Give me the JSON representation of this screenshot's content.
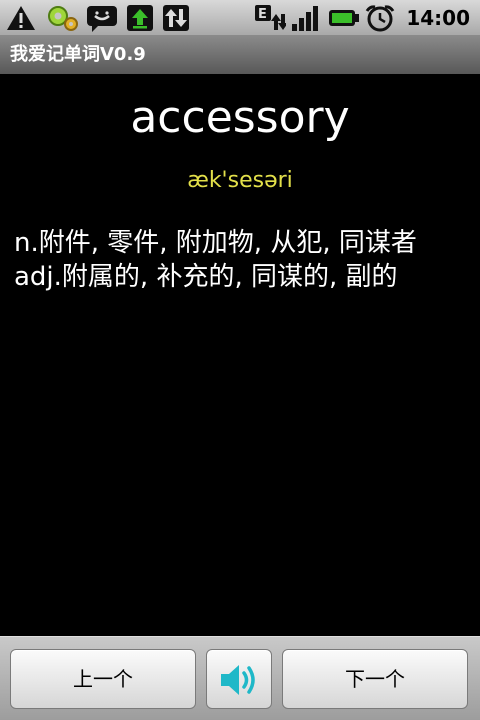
{
  "status_bar": {
    "icons": [
      "warning-icon",
      "settings-gear-icon",
      "chat-icon",
      "upload-icon",
      "data-transfer-icon",
      "edge-network-icon",
      "signal-icon",
      "battery-icon",
      "alarm-clock-icon"
    ],
    "time": "14:00",
    "colors": {
      "accent_green": "#3bbf2a",
      "background": "#bdbdbd"
    }
  },
  "app": {
    "title": "我爱记单词V0.9"
  },
  "word_card": {
    "word": "accessory",
    "phonetic": "æk'sesəri",
    "definition_lines": [
      "n.附件, 零件, 附加物, 从犯, 同谋者",
      "adj.附属的, 补充的, 同谋的, 副的"
    ],
    "colors": {
      "phonetic": "#e3e04a",
      "text": "#ffffff",
      "background": "#000000"
    }
  },
  "controls": {
    "prev_label": "上一个",
    "sound_icon": "speaker-icon",
    "next_label": "下一个",
    "colors": {
      "speaker": "#1fb8c8"
    }
  }
}
